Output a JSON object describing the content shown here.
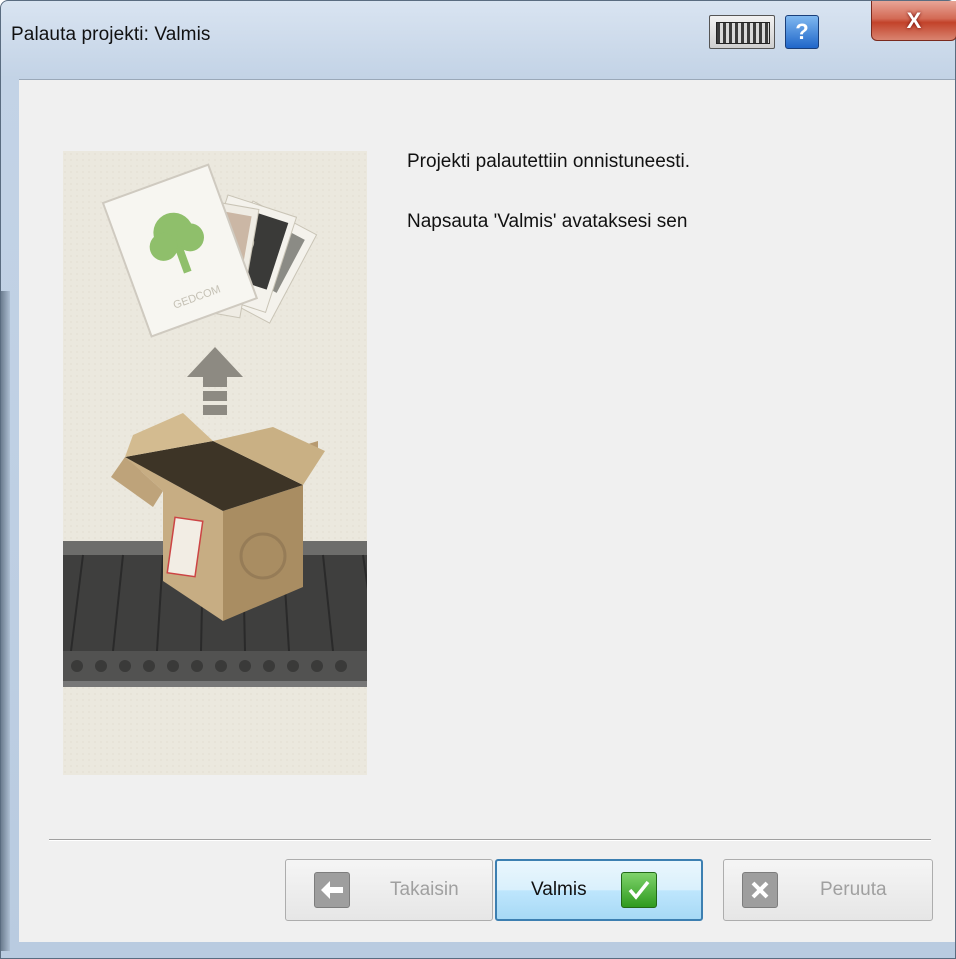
{
  "window": {
    "title": "Palauta projekti: Valmis"
  },
  "titlebar": {
    "keyboard_icon": "keyboard-icon",
    "help_label": "?",
    "close_label": "X"
  },
  "illustration": {
    "caption": "GEDCOM",
    "icon_names": [
      "tree-card-icon",
      "upload-arrow-icon",
      "cardboard-box-icon",
      "conveyor-belt-icon"
    ]
  },
  "main": {
    "message_line1": "Projekti palautettiin onnistuneesti.",
    "message_line2": "Napsauta 'Valmis' avataksesi sen"
  },
  "buttons": {
    "back": {
      "label": "Takaisin",
      "icon": "arrow-left-icon",
      "enabled": false
    },
    "finish": {
      "label": "Valmis",
      "icon": "checkmark-icon",
      "enabled": true
    },
    "cancel": {
      "label": "Peruuta",
      "icon": "x-icon",
      "enabled": false
    }
  },
  "colors": {
    "accent": "#3c7fb1",
    "finish_check": "#2e9a1f",
    "close_button": "#c2422a",
    "disabled_text": "#a0a0a0"
  }
}
